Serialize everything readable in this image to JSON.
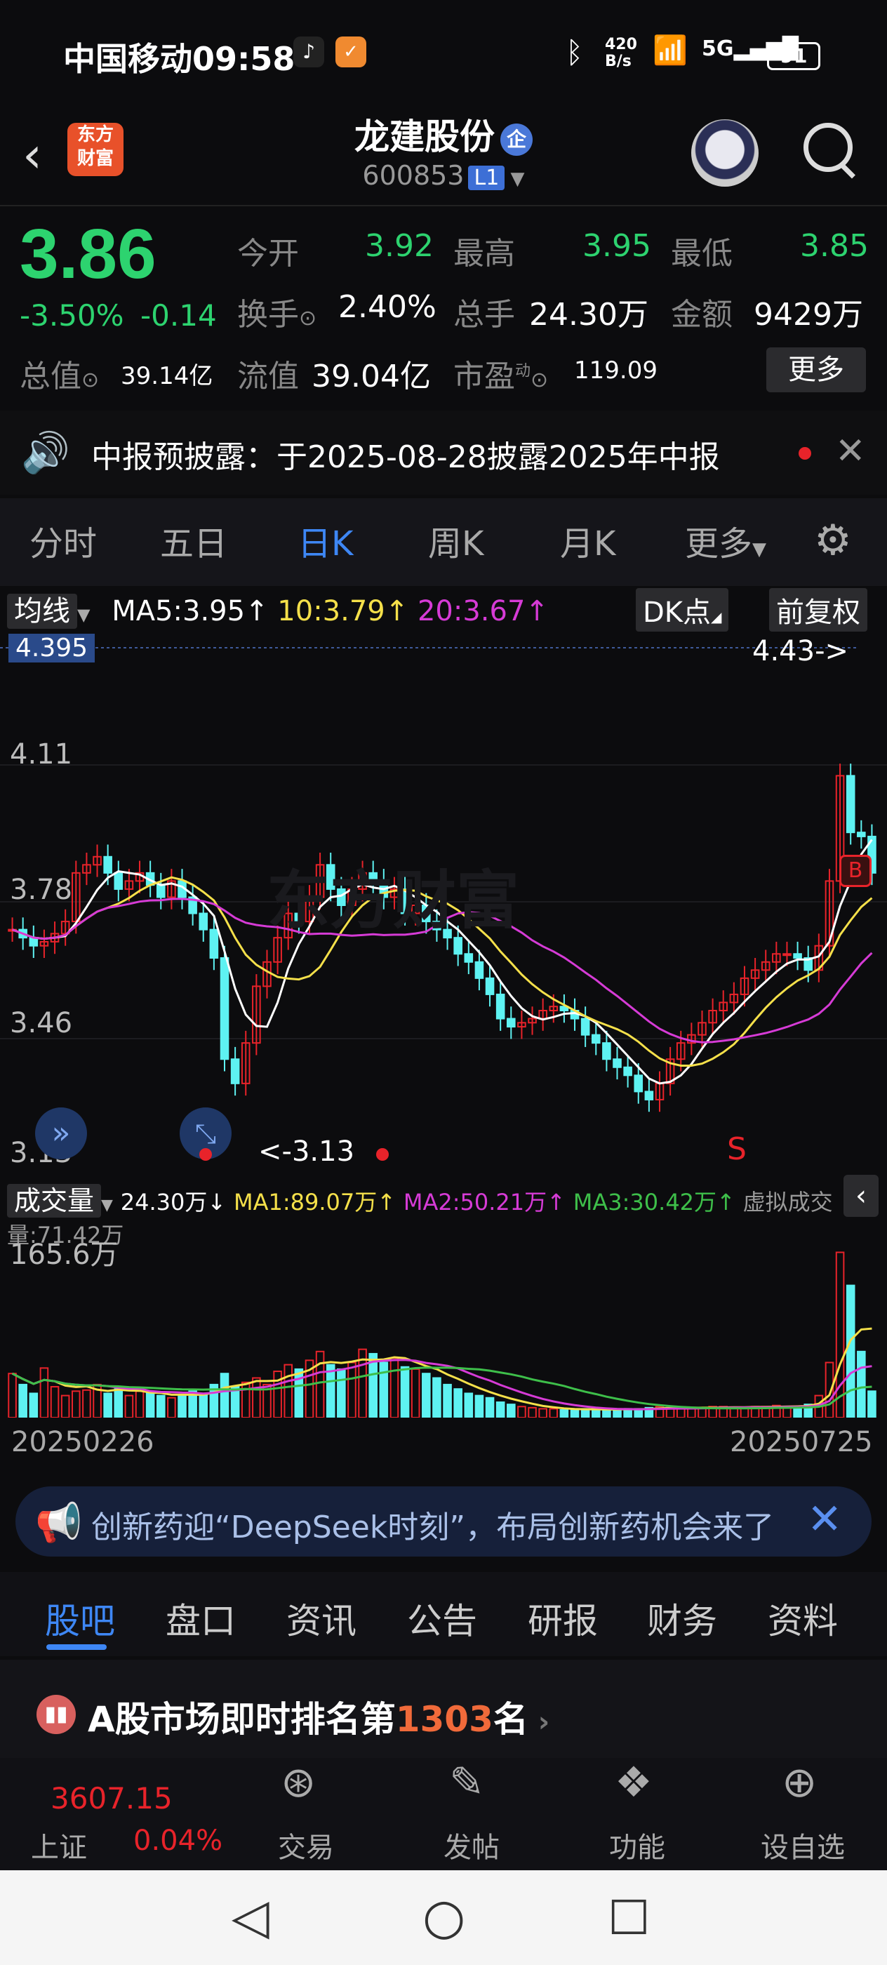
{
  "status": {
    "carrier_time": "中国移动09:58",
    "net_speed_top": "420",
    "net_speed_bottom": "B/s",
    "battery": "91"
  },
  "header": {
    "title": "龙建股份",
    "badge": "企",
    "code": "600853",
    "level": "L1",
    "logo_line1": "东方",
    "logo_line2": "财富"
  },
  "quote": {
    "price": "3.86",
    "change_pct": "-3.50%",
    "change": "-0.14",
    "open_label": "今开",
    "open": "3.92",
    "high_label": "最高",
    "high": "3.95",
    "low_label": "最低",
    "low": "3.85",
    "turnover_label": "换手",
    "turnover": "2.40%",
    "volume_label": "总手",
    "volume": "24.30万",
    "amount_label": "金额",
    "amount": "9429万",
    "mktcap_label": "总值",
    "mktcap": "39.14亿",
    "float_label": "流值",
    "float": "39.04亿",
    "pe_label": "市盈",
    "pe_sup": "动",
    "pe": "119.09",
    "more": "更多"
  },
  "notice": {
    "text": "中报预披露：于2025-08-28披露2025年中报"
  },
  "tabs": [
    "分时",
    "五日",
    "日K",
    "周K",
    "月K",
    "更多"
  ],
  "active_tab": "日K",
  "ma": {
    "label": "均线",
    "ma5": "MA5:3.95",
    "ma10": "10:3.79",
    "ma20": "20:3.67",
    "dk": "DK点",
    "fq": "前复权",
    "color5": "#ffffff",
    "color10": "#f5e04a",
    "color20": "#d63bd6"
  },
  "chart_labels": {
    "top_tag": "4.395",
    "y1": "4.11",
    "y2": "3.78",
    "y3": "3.46",
    "y4": "3.13",
    "high_mark": "4.43->",
    "low_mark": "<-3.13",
    "b_mark": "B",
    "s_mark": "S",
    "watermark": "东方财富"
  },
  "volume": {
    "label": "成交量",
    "current": "24.30万↓",
    "ma1": "MA1:89.07万↑",
    "ma2": "MA2:50.21万↑",
    "ma3": "MA3:30.42万↑",
    "virtual": "虚拟成交量:71.42万",
    "max": "165.6万",
    "start_date": "20250226",
    "end_date": "20250725"
  },
  "chart_data": {
    "type": "candlestick",
    "x_start": "20250226",
    "x_end": "20250725",
    "ylim": [
      3.13,
      4.43
    ],
    "notes": "daily K chart with MA lines and volume bars",
    "closes": [
      3.72,
      3.7,
      3.68,
      3.69,
      3.71,
      3.74,
      3.86,
      3.88,
      3.9,
      3.86,
      3.82,
      3.84,
      3.86,
      3.83,
      3.8,
      3.84,
      3.8,
      3.76,
      3.72,
      3.65,
      3.4,
      3.34,
      3.44,
      3.58,
      3.64,
      3.7,
      3.76,
      3.74,
      3.8,
      3.88,
      3.82,
      3.78,
      3.82,
      3.86,
      3.84,
      3.8,
      3.82,
      3.76,
      3.78,
      3.74,
      3.72,
      3.7,
      3.66,
      3.64,
      3.6,
      3.56,
      3.5,
      3.48,
      3.49,
      3.5,
      3.52,
      3.53,
      3.52,
      3.5,
      3.46,
      3.44,
      3.4,
      3.38,
      3.36,
      3.32,
      3.3,
      3.34,
      3.4,
      3.44,
      3.46,
      3.49,
      3.52,
      3.54,
      3.56,
      3.6,
      3.62,
      3.64,
      3.66,
      3.66,
      3.65,
      3.62,
      3.68,
      3.84,
      4.1,
      3.96,
      3.95,
      3.86
    ],
    "volumes": [
      40,
      30,
      22,
      45,
      28,
      20,
      24,
      25,
      30,
      22,
      26,
      20,
      24,
      22,
      20,
      18,
      20,
      24,
      22,
      30,
      40,
      28,
      32,
      36,
      30,
      42,
      48,
      44,
      52,
      60,
      48,
      44,
      50,
      62,
      58,
      50,
      54,
      46,
      44,
      40,
      36,
      30,
      26,
      22,
      20,
      18,
      14,
      12,
      10,
      9,
      8,
      8,
      7,
      7,
      8,
      8,
      7,
      7,
      8,
      8,
      9,
      10,
      9,
      8,
      9,
      9,
      10,
      10,
      9,
      9,
      10,
      10,
      11,
      10,
      10,
      12,
      20,
      50,
      150,
      120,
      60,
      24
    ]
  },
  "ad": {
    "text": "创新药迎“DeepSeek时刻”，布局创新药机会来了"
  },
  "subtabs": [
    "股吧",
    "盘口",
    "资讯",
    "公告",
    "研报",
    "财务",
    "资料"
  ],
  "rank": {
    "prefix": "A股市场即时排名第",
    "num": "1303",
    "suffix": "名"
  },
  "bottom": {
    "index_value": "3607.15",
    "index_name": "上证",
    "index_pct": "0.04%",
    "trade": "交易",
    "post": "发帖",
    "func": "功能",
    "fav": "设自选"
  },
  "colors": {
    "up": "#e8232a",
    "down": "#2dd36f",
    "cyan": "#5ef2f2",
    "accent": "#3e87f5"
  }
}
